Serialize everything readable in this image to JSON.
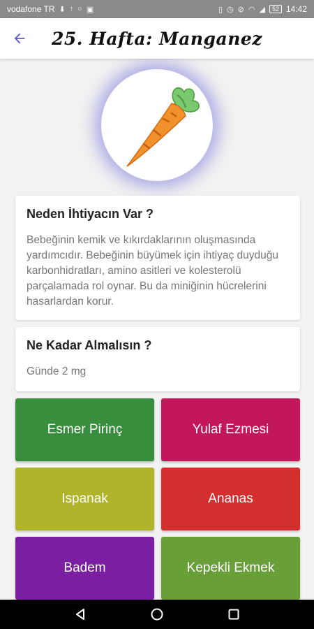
{
  "status_bar": {
    "carrier": "vodafone TR",
    "battery": "52",
    "time": "14:42"
  },
  "header": {
    "title": "25. Hafta: Manganez"
  },
  "hero": {
    "icon": "carrot-icon"
  },
  "why_card": {
    "title": "Neden İhtiyacın Var ?",
    "body": "Bebeğinin kemik ve kıkırdaklarının oluşmasında yardımcıdır. Bebeğinin büyümek için ihtiyaç duyduğu karbonhidratları, amino asitleri ve kolesterolü parçalamada rol oynar. Bu da miniğinin hücrelerini hasarlardan korur."
  },
  "amount_card": {
    "title": "Ne Kadar Almalısın ?",
    "body": "Günde 2 mg"
  },
  "foods": [
    {
      "label": "Esmer Pirinç",
      "color": "#388e3c"
    },
    {
      "label": "Yulaf Ezmesi",
      "color": "#c2185b"
    },
    {
      "label": "Ispanak",
      "color": "#afb42b"
    },
    {
      "label": "Ananas",
      "color": "#d32f2f"
    },
    {
      "label": "Badem",
      "color": "#7b1fa2"
    },
    {
      "label": "Kepekli Ekmek",
      "color": "#689f38"
    }
  ],
  "colors": {
    "accent": "#5c5cd6",
    "status_bar": "#8a8a8a"
  }
}
